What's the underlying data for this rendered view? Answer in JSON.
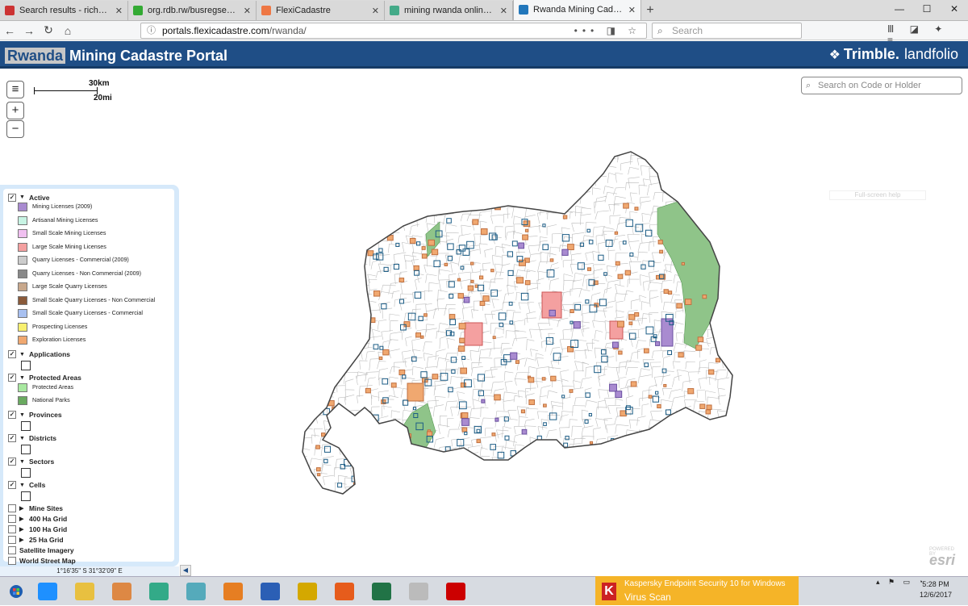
{
  "browser": {
    "tabs": [
      {
        "label": "Search results - richardniyongere@",
        "color": "#c33"
      },
      {
        "label": "org.rdb.rw/busregsearch/Search",
        "color": "#3a3"
      },
      {
        "label": "FlexiCadastre",
        "color": "#e74"
      },
      {
        "label": "mining rwanda online portal - G",
        "color": "#4a8"
      },
      {
        "label": "Rwanda Mining Cadastre Portal",
        "color": "#27b",
        "active": true
      }
    ],
    "url_host": "portals.flexicadastre.com",
    "url_path": "/rwanda/",
    "search_placeholder": "Search",
    "url_actions": "•••",
    "nav": {
      "back": "←",
      "forward": "→",
      "reload": "↻",
      "home": "⌂"
    }
  },
  "app": {
    "title_rw": "Rwanda",
    "title_rest": " Mining Cadastre Portal",
    "brand1": "Trimble.",
    "brand2": "landfolio"
  },
  "map": {
    "menu_icon": "≡",
    "zoom_in": "+",
    "zoom_out": "−",
    "scale_km": "30km",
    "scale_mi": "20mi",
    "search_placeholder": "Search on Code or Holder",
    "fullscreen_text": "Full-screen help",
    "coords": "1°16'35\" S   31°32'09\" E",
    "esri_attr": "POWERED BY",
    "esri": "esri",
    "colors": {
      "national_park": "#8fc489",
      "boundary": "#444444",
      "exploration": "#f0a870",
      "large_mining": "#f4a0a0",
      "app_outline": "#1b5c85",
      "mining2009": "#a98bd0"
    }
  },
  "legend": {
    "active_label": "Active",
    "active_items": [
      {
        "label": "Mining Licenses (2009)",
        "color": "#a98bd0"
      },
      {
        "label": "Artisanal Mining Licenses",
        "color": "#c8f4e4"
      },
      {
        "label": "Small Scale Mining Licenses",
        "color": "#f0c0f0"
      },
      {
        "label": "Large Scale Mining Licenses",
        "color": "#f4a0a0"
      },
      {
        "label": "Quarry Licenses - Commercial (2009)",
        "color": "#cccccc"
      },
      {
        "label": "Quarry Licenses - Non Commercial (2009)",
        "color": "#888888"
      },
      {
        "label": "Large Scale Quarry Licenses",
        "color": "#c8a88c"
      },
      {
        "label": "Small Scale Quarry Licenses - Non Commercial",
        "color": "#8a5a3a"
      },
      {
        "label": "Small Scale Quarry Licenses - Commercial",
        "color": "#a8c0f0"
      },
      {
        "label": "Prospecting Licenses",
        "color": "#f8f070"
      },
      {
        "label": "Exploration Licenses",
        "color": "#f0a870"
      }
    ],
    "applications_label": "Applications",
    "protected_label": "Protected Areas",
    "protected_items": [
      {
        "label": "Protected Areas",
        "color": "#a8e8a0"
      },
      {
        "label": "National Parks",
        "color": "#6aaa60"
      }
    ],
    "provinces_label": "Provinces",
    "districts_label": "Districts",
    "sectors_label": "Sectors",
    "cells_label": "Cells",
    "mine_sites_label": "Mine Sites",
    "grid400_label": "400 Ha Grid",
    "grid100_label": "100 Ha Grid",
    "grid25_label": "25 Ha Grid",
    "satellite_label": "Satellite Imagery",
    "street_label": "World Street Map",
    "check": "✓",
    "collapse": "◀"
  },
  "taskbar": {
    "toast_title": "Kaspersky Endpoint Security 10 for Windows",
    "toast_text": "Virus Scan",
    "toast_logo": "K",
    "time": "5:28 PM",
    "date": "12/6/2017",
    "apps": [
      "#1e90ff",
      "#e8c040",
      "#d84",
      "#3a8",
      "#5ab",
      "#e67e22",
      "#2b5fb5",
      "#d4a800",
      "#e65c1c",
      "#217346",
      "#bbb",
      "#c00"
    ]
  }
}
